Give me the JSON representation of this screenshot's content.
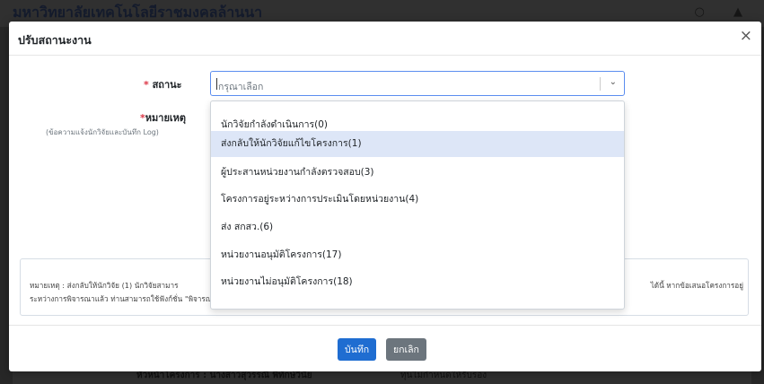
{
  "background": {
    "title": "มหาวิทยาลัยเทคโนโลยีราชมงคลล้านนา",
    "row_label": "หัวหน้าโครงการ : นางสาวสุวรรณี พิทักษ์วินัย",
    "row_value": "ทุนไม่กำหนดให้รับรอง"
  },
  "modal": {
    "title": "ปรับสถานะงาน",
    "status_label": "สถานะ",
    "remark_label": "หมายเหตุ",
    "remark_sublabel": "(ข้อความแจ้งนักวิจัยและบันทึก Log)",
    "select_placeholder": "กรุณาเลือก",
    "options": [
      "นักวิจัยกำลังดำเนินการ(0)",
      "ส่งกลับให้นักวิจัยแก้ไขโครงการ(1)",
      "ผู้ประสานหน่วยงานกำลังตรวจสอบ(3)",
      "โครงการอยู่ระหว่างการประเมินโดยหน่วยงาน(4)",
      "ส่ง สกสว.(6)",
      "หน่วยงานอนุมัติโครงการ(17)",
      "หน่วยงานไม่อนุมัติโครงการ(18)"
    ],
    "active_option_index": 1,
    "note_line1": "หมายเหตุ : ส่งกลับให้นักวิจัย (1) นักวิจัยสามาร",
    "note_line1_end": "ได้นี้ หากข้อเสนอโครงการอยู่",
    "note_line2": "ระหว่างการพิจารณาแล้ว ท่านสามารถใช้ฟังก์ชั่น \"พิจารณา\" และเพิ่ม \"รายการส่งข้อเสนอให้นักวิจัยปรับแก้\" ได้โดยไม่ต้องทำการปรับสถานะข้อเสนอโครงการ",
    "save_label": "บันทึก",
    "cancel_label": "ยกเลิก",
    "close_icon": "×"
  }
}
